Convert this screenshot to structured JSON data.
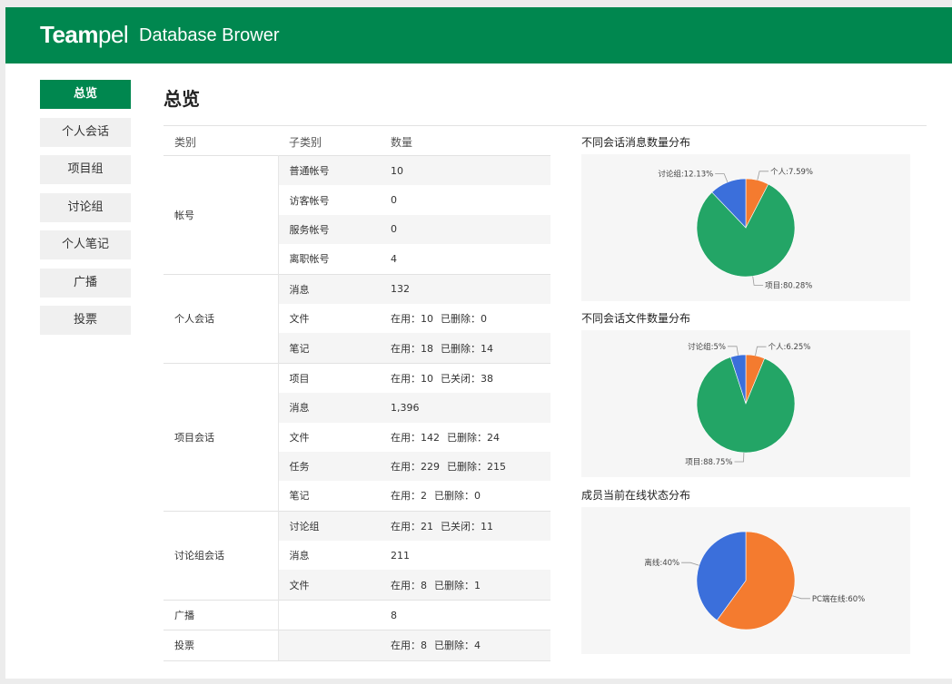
{
  "header": {
    "brand_bold": "Team",
    "brand_light": "pel",
    "app_title": "Database Brower"
  },
  "sidebar": {
    "items": [
      {
        "label": "总览",
        "active": true
      },
      {
        "label": "个人会话"
      },
      {
        "label": "项目组"
      },
      {
        "label": "讨论组"
      },
      {
        "label": "个人笔记"
      },
      {
        "label": "广播"
      },
      {
        "label": "投票"
      }
    ]
  },
  "main": {
    "title": "总览",
    "table": {
      "headers": [
        "类别",
        "子类别",
        "数量"
      ],
      "groups": [
        {
          "category": "帐号",
          "rows": [
            {
              "sub": "普通帐号",
              "value": [
                "10"
              ]
            },
            {
              "sub": "访客帐号",
              "value": [
                "0"
              ]
            },
            {
              "sub": "服务帐号",
              "value": [
                "0"
              ]
            },
            {
              "sub": "离职帐号",
              "value": [
                "4"
              ]
            }
          ]
        },
        {
          "category": "个人会话",
          "rows": [
            {
              "sub": "消息",
              "value": [
                "132"
              ]
            },
            {
              "sub": "文件",
              "value": [
                "在用：10",
                "已删除：0"
              ]
            },
            {
              "sub": "笔记",
              "value": [
                "在用：18",
                "已删除：14"
              ]
            }
          ]
        },
        {
          "category": "项目会话",
          "rows": [
            {
              "sub": "项目",
              "value": [
                "在用：10",
                "已关闭：38"
              ]
            },
            {
              "sub": "消息",
              "value": [
                "1,396"
              ]
            },
            {
              "sub": "文件",
              "value": [
                "在用：142",
                "已删除：24"
              ]
            },
            {
              "sub": "任务",
              "value": [
                "在用：229",
                "已删除：215"
              ]
            },
            {
              "sub": "笔记",
              "value": [
                "在用：2",
                "已删除：0"
              ]
            }
          ]
        },
        {
          "category": "讨论组会话",
          "rows": [
            {
              "sub": "讨论组",
              "value": [
                "在用：21",
                "已关闭：11"
              ]
            },
            {
              "sub": "消息",
              "value": [
                "211"
              ]
            },
            {
              "sub": "文件",
              "value": [
                "在用：8",
                "已删除：1"
              ]
            }
          ]
        },
        {
          "category": "广播",
          "rows": [
            {
              "sub": "",
              "value": [
                "8"
              ]
            }
          ]
        },
        {
          "category": "投票",
          "rows": [
            {
              "sub": "",
              "value": [
                "在用：8",
                "已删除：4"
              ]
            }
          ]
        }
      ]
    }
  },
  "chart_data": [
    {
      "type": "pie",
      "title": "不同会话消息数量分布",
      "slices": [
        {
          "label": "个人:7.59%",
          "value": 7.59,
          "color": "#f47b2f"
        },
        {
          "label": "项目:80.28%",
          "value": 80.28,
          "color": "#23a566"
        },
        {
          "label": "讨论组:12.13%",
          "value": 12.13,
          "color": "#3b6fdb"
        }
      ]
    },
    {
      "type": "pie",
      "title": "不同会话文件数量分布",
      "slices": [
        {
          "label": "个人:6.25%",
          "value": 6.25,
          "color": "#f47b2f"
        },
        {
          "label": "项目:88.75%",
          "value": 88.75,
          "color": "#23a566"
        },
        {
          "label": "讨论组:5%",
          "value": 5,
          "color": "#3b6fdb"
        }
      ]
    },
    {
      "type": "pie",
      "title": "成员当前在线状态分布",
      "slices": [
        {
          "label": "PC端在线:60%",
          "value": 60,
          "color": "#f47b2f"
        },
        {
          "label": "离线:40%",
          "value": 40,
          "color": "#3b6fdb"
        }
      ]
    }
  ]
}
